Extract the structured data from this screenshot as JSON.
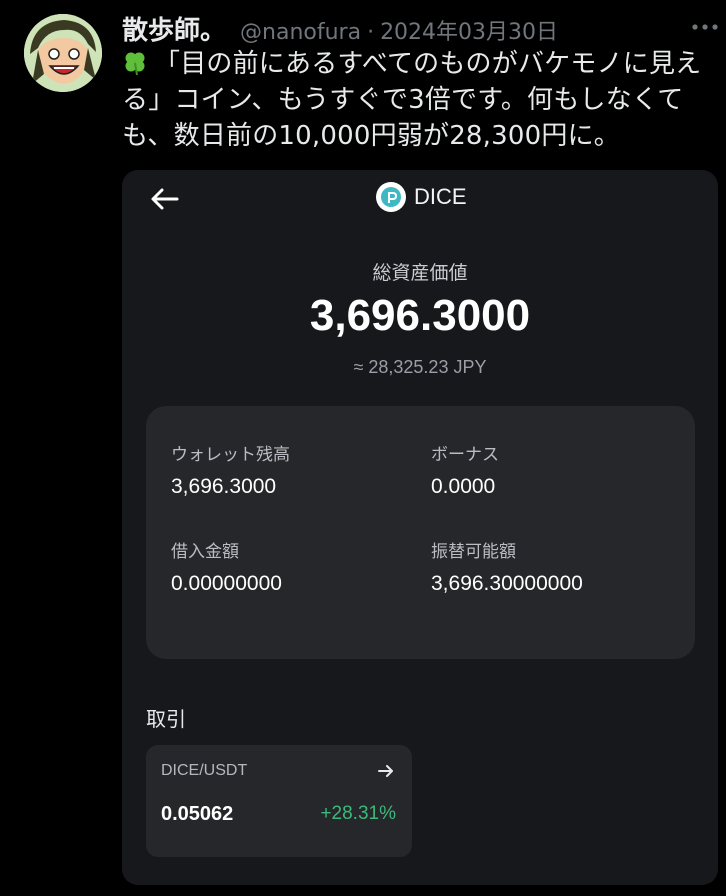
{
  "tweet": {
    "author_name": "散歩師。",
    "handle": "@nanofura",
    "separator": "·",
    "date": "2024年03月30日",
    "avatar_icon": "avatar-cartoon-icon",
    "more_icon": "more-dots-icon",
    "emoji_icon": "four-leaf-clover-icon",
    "text": "「目の前にあるすべてのものがバケモノに見える」コイン、もうすぐで3倍です。何もしなくても、数日前の10,000円弱が28,300円に。"
  },
  "app": {
    "back_icon": "back-arrow-icon",
    "logo_icon": "dice-logo-icon",
    "title": "DICE",
    "total_label": "総資産価値",
    "total_value": "3,696.3000",
    "total_jpy": "≈ 28,325.23 JPY",
    "balances": {
      "wallet_label": "ウォレット残高",
      "wallet_value": "3,696.3000",
      "bonus_label": "ボーナス",
      "bonus_value": "0.0000",
      "borrowed_label": "借入金額",
      "borrowed_value": "0.00000000",
      "transferable_label": "振替可能額",
      "transferable_value": "3,696.30000000"
    },
    "trade": {
      "section_title": "取引",
      "pair": "DICE/USDT",
      "arrow_icon": "arrow-right-icon",
      "price": "0.05062",
      "change": "+28.31%",
      "change_color": "#3bb97a"
    }
  }
}
